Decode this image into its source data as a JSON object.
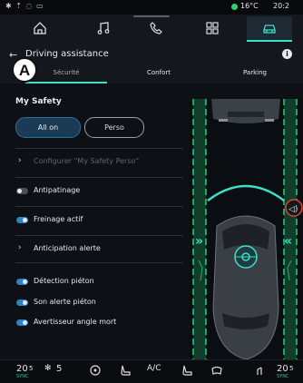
{
  "status": {
    "temperature": "16°C",
    "time": "20:2"
  },
  "header": {
    "back": "←",
    "title": "Driving assistance",
    "info": "i"
  },
  "callout": "A",
  "tabs": [
    {
      "label": "Sécurité"
    },
    {
      "label": "Confort"
    },
    {
      "label": "Parking"
    }
  ],
  "section_title": "My Safety",
  "segment": {
    "allon": "All on",
    "perso": "Perso"
  },
  "rows": [
    {
      "label": "Configurer \"My Safety Perso\"",
      "type": "link",
      "enabled": false
    },
    {
      "label": "Antipatinage",
      "type": "toggle",
      "on": false
    },
    {
      "label": "Freinage actif",
      "type": "toggle",
      "on": true
    },
    {
      "label": "Anticipation alerte",
      "type": "link",
      "enabled": true
    },
    {
      "label": "Détection piéton",
      "type": "toggle",
      "on": true
    },
    {
      "label": "Son alerte piéton",
      "type": "toggle",
      "on": true
    },
    {
      "label": "Avertisseur angle mort",
      "type": "toggle",
      "on": true
    }
  ],
  "bottom": {
    "left_temp": "20",
    "left_temp_unit": "5",
    "fan": "5",
    "fan_unit": "",
    "ac": "A/C",
    "right_temp": "20",
    "right_temp_unit": "5",
    "left_sync": "SYNC",
    "right_sync": "SYNC"
  },
  "colors": {
    "accent": "#3de0c6",
    "lane": "#26d07a",
    "toggle_on": "#2f83c0",
    "alert": "#e0423a"
  }
}
